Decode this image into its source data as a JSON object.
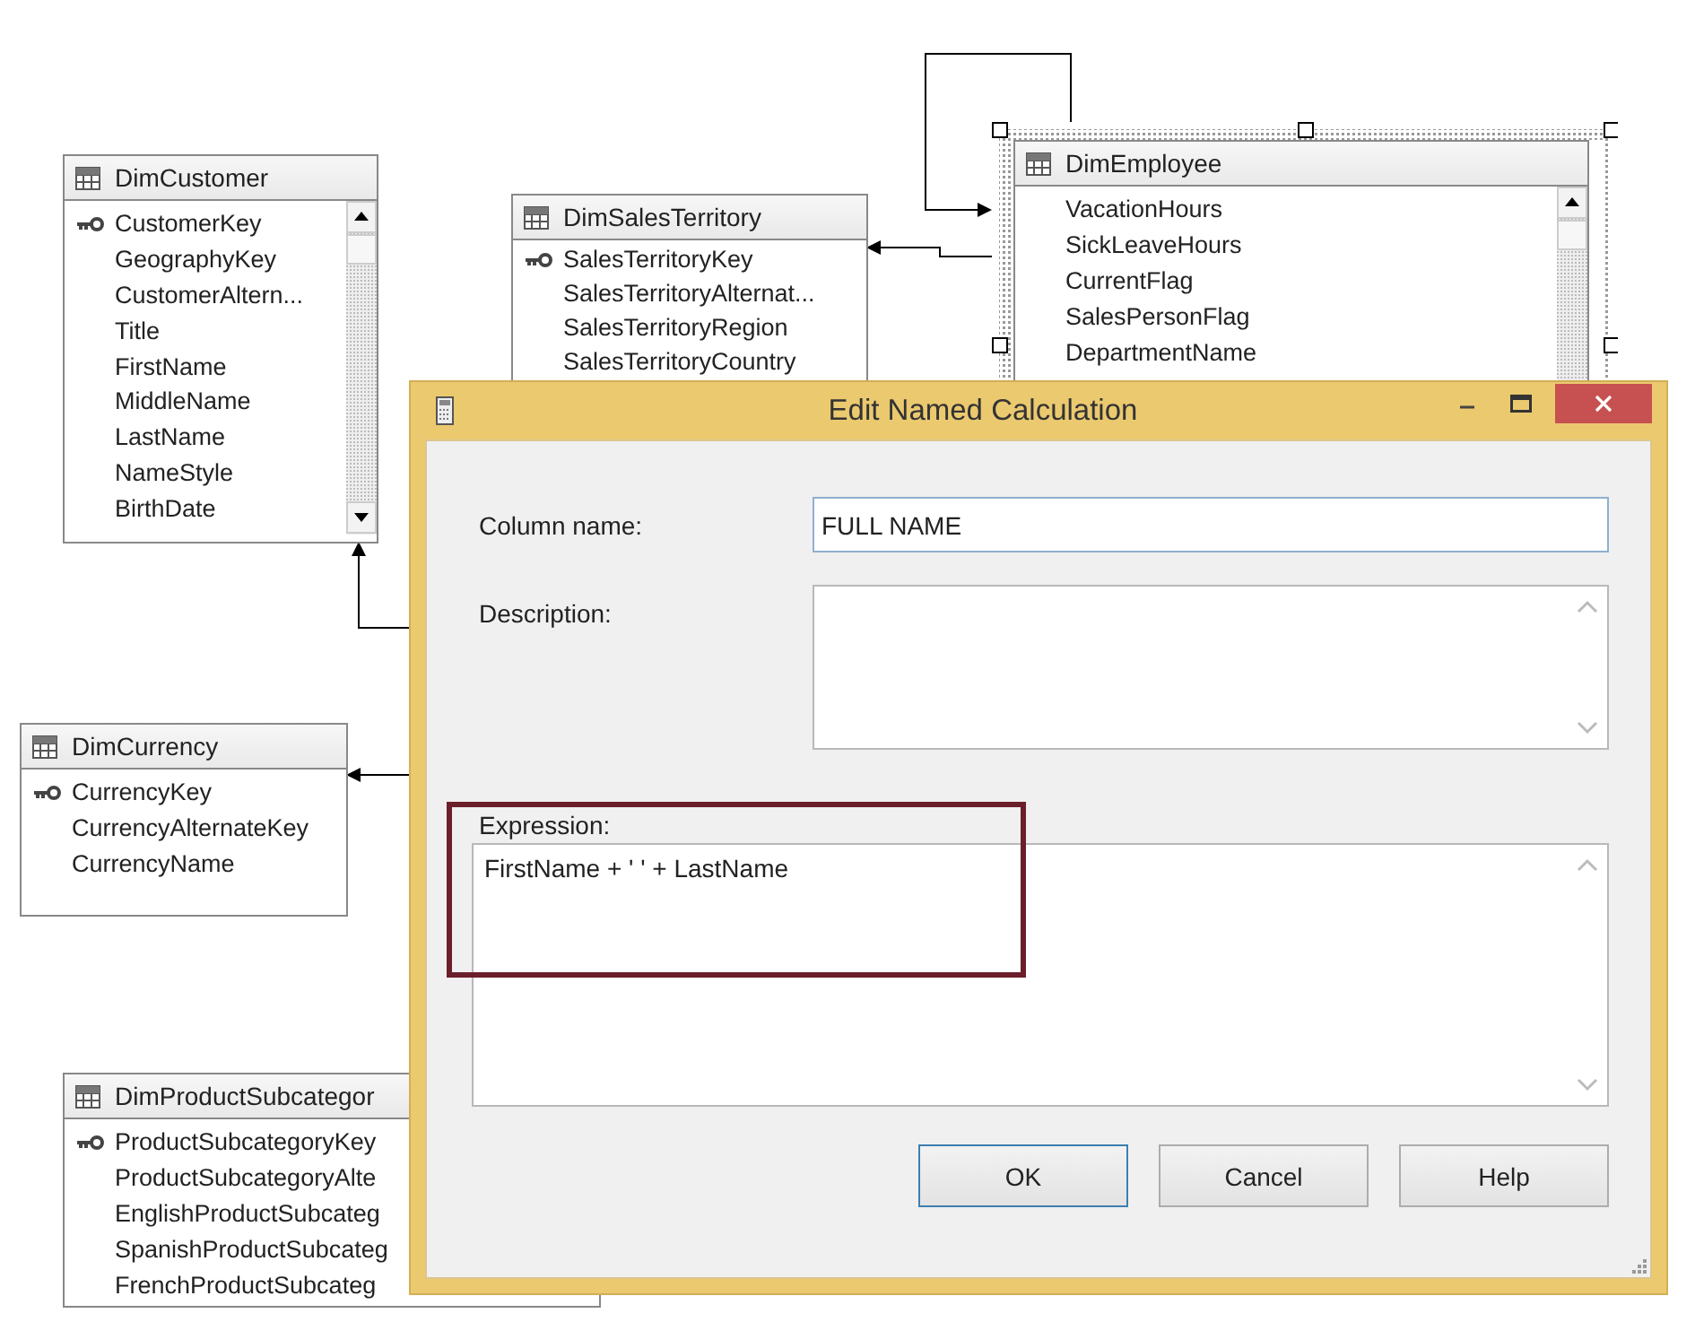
{
  "diagram": {
    "tables": [
      {
        "name": "DimCustomer",
        "selected": false,
        "scrollable": true,
        "columns": [
          {
            "name": "CustomerKey",
            "key": true
          },
          {
            "name": "GeographyKey",
            "key": false
          },
          {
            "name": "CustomerAltern...",
            "key": false
          },
          {
            "name": "Title",
            "key": false
          },
          {
            "name": "FirstName",
            "key": false
          },
          {
            "name": "MiddleName",
            "key": false
          },
          {
            "name": "LastName",
            "key": false
          },
          {
            "name": "NameStyle",
            "key": false
          },
          {
            "name": "BirthDate",
            "key": false
          }
        ]
      },
      {
        "name": "DimSalesTerritory",
        "selected": false,
        "scrollable": false,
        "columns": [
          {
            "name": "SalesTerritoryKey",
            "key": true
          },
          {
            "name": "SalesTerritoryAlternat...",
            "key": false
          },
          {
            "name": "SalesTerritoryRegion",
            "key": false
          },
          {
            "name": "SalesTerritoryCountry",
            "key": false
          }
        ]
      },
      {
        "name": "DimEmployee",
        "selected": true,
        "scrollable": true,
        "columns": [
          {
            "name": "VacationHours",
            "key": false
          },
          {
            "name": "SickLeaveHours",
            "key": false
          },
          {
            "name": "CurrentFlag",
            "key": false
          },
          {
            "name": "SalesPersonFlag",
            "key": false
          },
          {
            "name": "DepartmentName",
            "key": false
          }
        ]
      },
      {
        "name": "DimCurrency",
        "selected": false,
        "scrollable": false,
        "columns": [
          {
            "name": "CurrencyKey",
            "key": true
          },
          {
            "name": "CurrencyAlternateKey",
            "key": false
          },
          {
            "name": "CurrencyName",
            "key": false
          }
        ]
      },
      {
        "name": "DimProductSubcategor",
        "selected": false,
        "scrollable": false,
        "columns": [
          {
            "name": "ProductSubcategoryKey",
            "key": true
          },
          {
            "name": "ProductSubcategoryAlte",
            "key": false
          },
          {
            "name": "EnglishProductSubcateg",
            "key": false
          },
          {
            "name": "SpanishProductSubcateg",
            "key": false
          },
          {
            "name": "FrenchProductSubcateg",
            "key": false
          }
        ]
      }
    ]
  },
  "dialog": {
    "title": "Edit Named Calculation",
    "fields": [
      {
        "label": "Column name:",
        "value": "FULL NAME",
        "kind": "line"
      },
      {
        "label": "Description:",
        "kind": "multiline"
      }
    ],
    "expression": {
      "label": "Expression:",
      "value": "FirstName + ' ' + LastName",
      "highlighted": true
    },
    "buttons": [
      {
        "label": "OK",
        "default": true
      },
      {
        "label": "Cancel",
        "default": false
      },
      {
        "label": "Help",
        "default": false
      }
    ]
  }
}
